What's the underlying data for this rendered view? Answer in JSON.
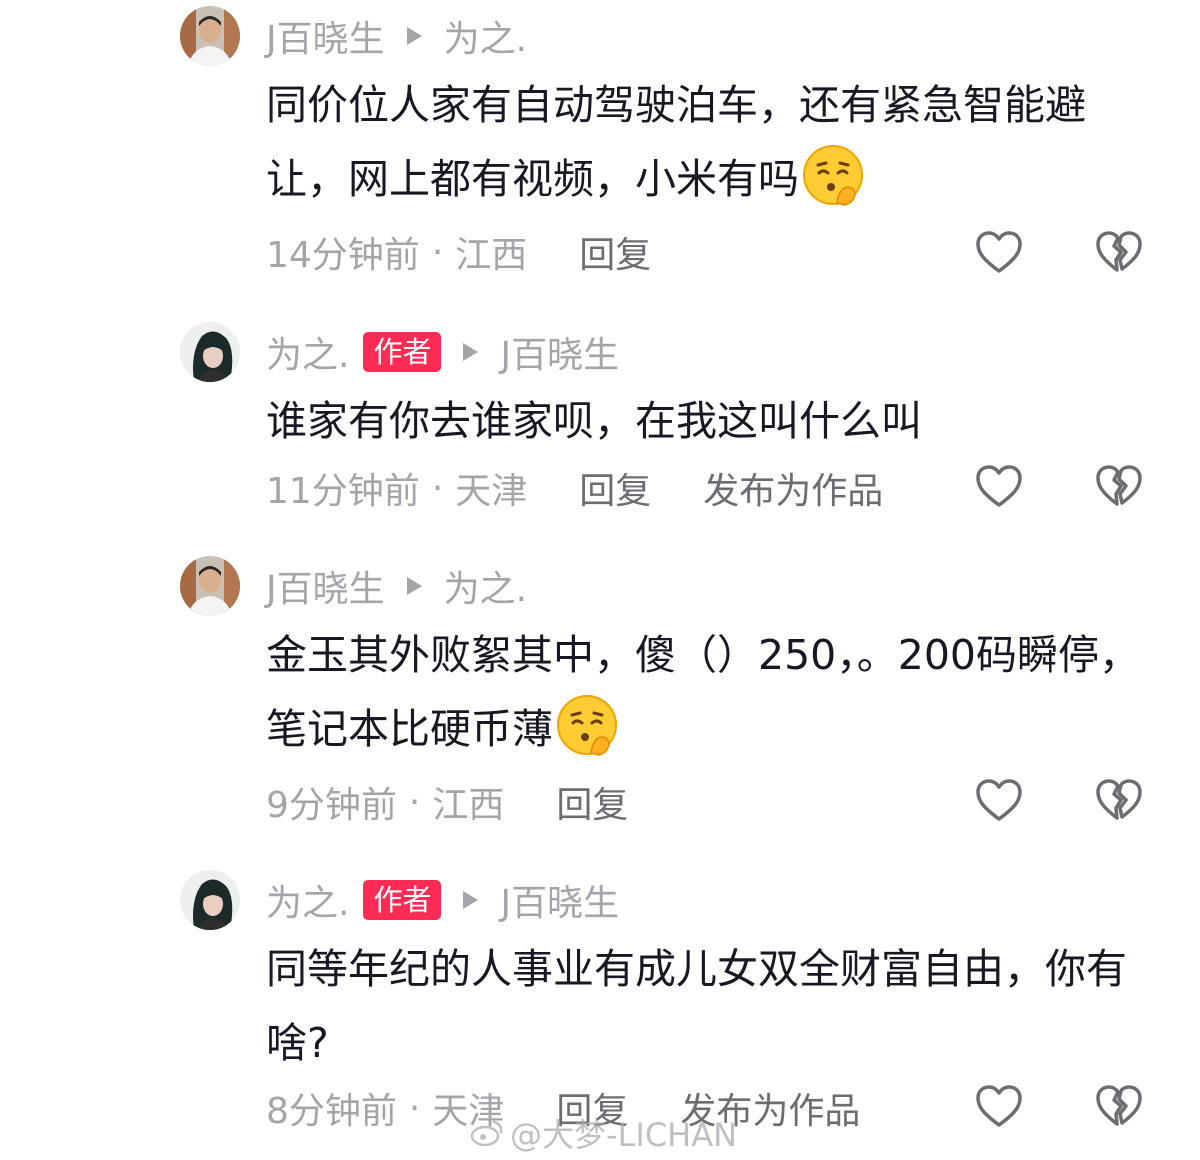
{
  "comments": [
    {
      "author": "J百晓生",
      "author_badge": "",
      "reply_to": "为之.",
      "text": "同价位人家有自动驾驶泊车，还有紧急智能避让，网上都有视频，小米有吗",
      "time": "14分钟前",
      "location": "江西",
      "reply_label": "回复",
      "publish_label": "",
      "emoji": "thinking-emoji"
    },
    {
      "author": "为之.",
      "author_badge": "作者",
      "reply_to": "J百晓生",
      "text": "谁家有你去谁家呗，在我这叫什么叫",
      "time": "11分钟前",
      "location": "天津",
      "reply_label": "回复",
      "publish_label": "发布为作品",
      "emoji": ""
    },
    {
      "author": "J百晓生",
      "author_badge": "",
      "reply_to": "为之.",
      "text": "金玉其外败絮其中，傻（）250，。200码瞬停，笔记本比硬币薄",
      "time": "9分钟前",
      "location": "江西",
      "reply_label": "回复",
      "publish_label": "",
      "emoji": "thinking-emoji"
    },
    {
      "author": "为之.",
      "author_badge": "作者",
      "reply_to": "J百晓生",
      "text": "同等年纪的人事业有成儿女双全财富自由，你有啥?",
      "time": "8分钟前",
      "location": "天津",
      "reply_label": "回复",
      "publish_label": "发布为作品",
      "emoji": ""
    }
  ],
  "separator": "·",
  "watermark": "@大梦-LICHAN",
  "colors": {
    "badge": "#fe2c55",
    "muted_text": "#a3a5ab",
    "body_text": "#161823",
    "icon_stroke": "#6b6d73"
  },
  "icons": {
    "like": "heart-outline-icon",
    "dislike": "broken-heart-outline-icon",
    "reply_arrow": "triangle-right-icon"
  }
}
